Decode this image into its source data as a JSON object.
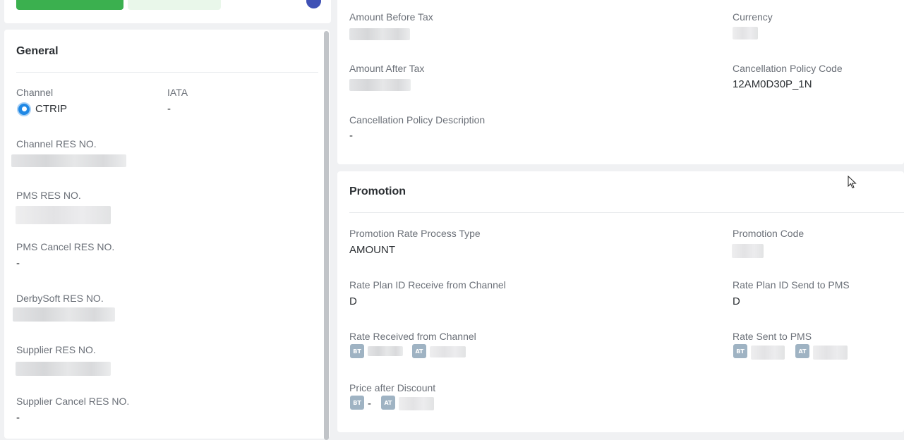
{
  "general": {
    "title": "General",
    "channel_label": "Channel",
    "channel_value": "CTRIP",
    "iata_label": "IATA",
    "iata_value": "-",
    "channel_res_label": "Channel RES NO.",
    "pms_res_label": "PMS RES NO.",
    "pms_cancel_res_label": "PMS Cancel RES NO.",
    "pms_cancel_res_value": "-",
    "derbysoft_res_label": "DerbySoft RES NO.",
    "supplier_res_label": "Supplier RES NO.",
    "supplier_cancel_res_label": "Supplier Cancel RES NO.",
    "supplier_cancel_res_value": "-"
  },
  "rate": {
    "amount_before_tax_label": "Amount Before Tax",
    "currency_label": "Currency",
    "amount_after_tax_label": "Amount After Tax",
    "cancel_policy_code_label": "Cancellation Policy Code",
    "cancel_policy_code_value": "12AM0D30P_1N",
    "cancel_policy_desc_label": "Cancellation Policy Description",
    "cancel_policy_desc_value": "-"
  },
  "promotion": {
    "title": "Promotion",
    "process_type_label": "Promotion Rate Process Type",
    "process_type_value": "AMOUNT",
    "promo_code_label": "Promotion Code",
    "rate_plan_receive_label": "Rate Plan ID Receive from Channel",
    "rate_plan_receive_value": "D",
    "rate_plan_send_label": "Rate Plan ID Send to PMS",
    "rate_plan_send_value": "D",
    "rate_received_label": "Rate Received from Channel",
    "rate_sent_label": "Rate Sent to PMS",
    "price_after_discount_label": "Price after Discount",
    "price_after_discount_bt_value": "-",
    "badge_bt": "BT",
    "badge_at": "AT"
  },
  "colors": {
    "accent_green": "#3bb04f",
    "channel_blue": "#1f88e5",
    "badge": "#9fb3c3"
  },
  "icons": {
    "channel": "ctrip-logo-icon",
    "cursor": "mouse-pointer-icon"
  }
}
